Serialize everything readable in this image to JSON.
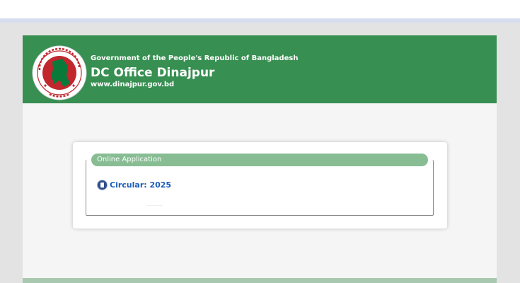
{
  "header": {
    "government_line": "Government of the People's Republic of Bangladesh",
    "office_title": "DC Office Dinajpur",
    "website": "www.dinajpur.gov.bd",
    "seal_icon": "bangladesh-government-seal-icon",
    "background_color": "#378f51"
  },
  "application_panel": {
    "legend": "Online Application",
    "legend_color": "#88bd94",
    "links": [
      {
        "icon": "pdf-icon",
        "label": "Circular: 2025"
      }
    ]
  },
  "colors": {
    "link": "#1a5db8",
    "page_background": "#f5f5f5"
  }
}
